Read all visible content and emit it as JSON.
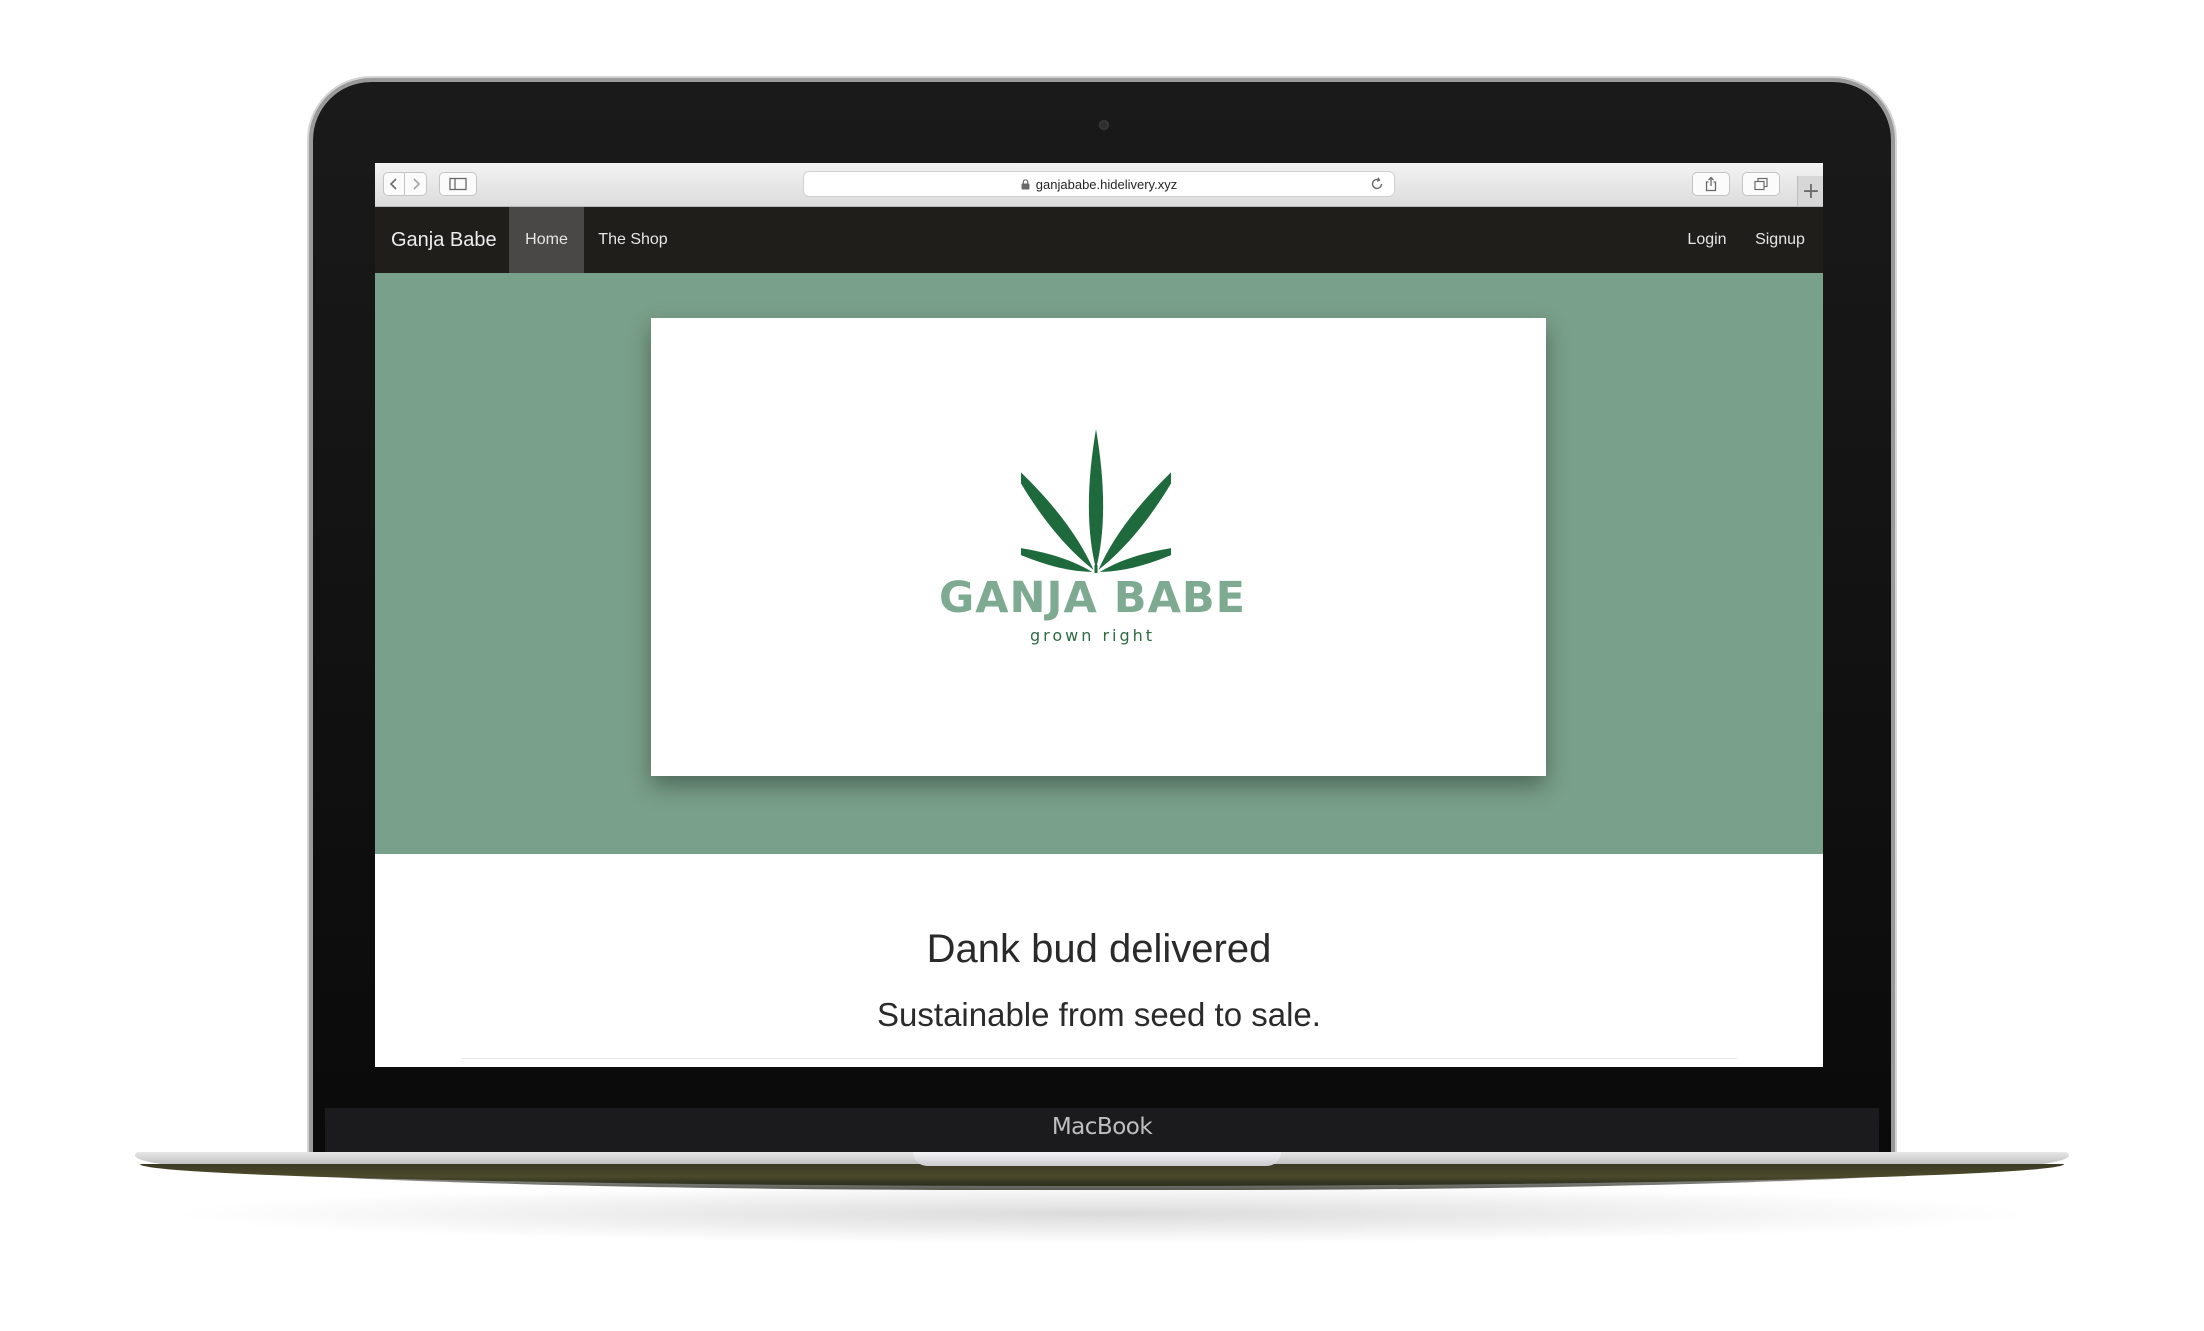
{
  "device": {
    "label": "MacBook"
  },
  "browser": {
    "url": "ganjababe.hidelivery.xyz",
    "back_icon": "chevron-left-icon",
    "forward_icon": "chevron-right-icon",
    "sidebar_icon": "sidebar-icon",
    "lock_icon": "lock-icon",
    "reload_icon": "reload-icon",
    "share_icon": "share-icon",
    "tabs_icon": "tabs-icon",
    "new_tab_label": "+"
  },
  "navbar": {
    "brand": "Ganja Babe",
    "items": [
      {
        "label": "Home",
        "active": true
      },
      {
        "label": "The Shop",
        "active": false
      }
    ],
    "right_items": [
      {
        "label": "Login"
      },
      {
        "label": "Signup"
      }
    ]
  },
  "hero": {
    "background": "#79a08a",
    "logo": {
      "name": "GANJA BABE",
      "tagline": "grown right",
      "leaf_color": "#1f6a3c",
      "name_color": "#7eaa92"
    }
  },
  "main": {
    "headline": "Dank bud delivered",
    "subheadline": "Sustainable from seed to sale."
  }
}
